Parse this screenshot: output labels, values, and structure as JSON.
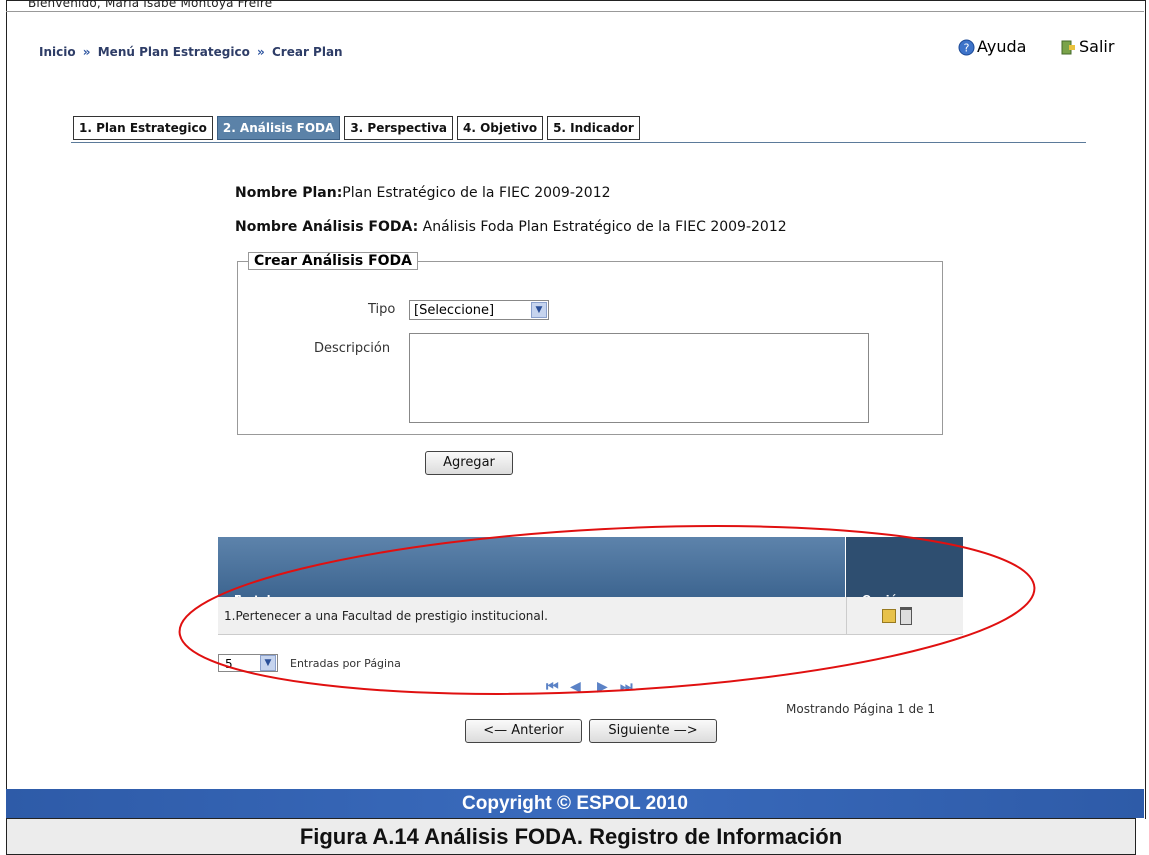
{
  "header": {
    "welcome": "Bienvenido, Maria Isabe Montoya Freire",
    "breadcrumb": [
      "Inicio",
      "Menú Plan Estrategico",
      "Crear Plan"
    ],
    "help_label": "Ayuda",
    "exit_label": "Salir"
  },
  "tabs": [
    {
      "label": "1. Plan Estrategico",
      "active": false
    },
    {
      "label": "2. Análisis FODA",
      "active": true
    },
    {
      "label": "3. Perspectiva",
      "active": false
    },
    {
      "label": "4. Objetivo",
      "active": false
    },
    {
      "label": "5. Indicador",
      "active": false
    }
  ],
  "info": {
    "plan_label": "Nombre Plan:",
    "plan_value": "Plan Estratégico de la FIEC 2009-2012",
    "foda_label": "Nombre Análisis FODA:",
    "foda_value": " Análisis Foda Plan Estratégico de la FIEC 2009-2012"
  },
  "form": {
    "legend": "Crear Análisis FODA",
    "tipo_label": "Tipo",
    "tipo_value": "[Seleccione]",
    "descripcion_label": "Descripción",
    "add_label": "Agregar"
  },
  "grid": {
    "col1": "Fortalezas",
    "col2": "Opción",
    "rows": [
      {
        "text": "1.Pertenecer a una Facultad de prestigio institucional."
      }
    ]
  },
  "pager": {
    "entries_value": "5",
    "entries_label": "Entradas por Página",
    "status": "Mostrando Página 1 de 1",
    "prev_label": "<— Anterior",
    "next_label": "Siguiente —>"
  },
  "footer": {
    "copyright": "Copyright © ESPOL 2010"
  },
  "caption": "Figura A.14 Análisis FODA. Registro de Información"
}
